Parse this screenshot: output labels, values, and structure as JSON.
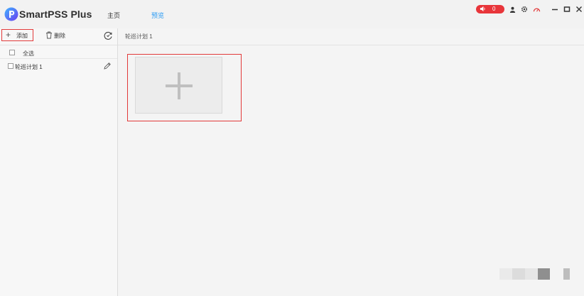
{
  "app": {
    "title": "SmartPSS Plus"
  },
  "nav": {
    "tabs": [
      {
        "label": "主页"
      },
      {
        "label": "预览"
      }
    ]
  },
  "alarm": {
    "count": "0"
  },
  "toolbar": {
    "add_label": "添加",
    "delete_label": "删除"
  },
  "list": {
    "select_all_label": "全选",
    "items": [
      {
        "label": "轮巡计划 1"
      }
    ]
  },
  "main": {
    "title": "轮巡计划 1"
  },
  "colors": {
    "accent": "#2b9bf4",
    "alarm": "#e8353a",
    "highlight": "#e23a3a"
  },
  "icons": [
    "app-logo-icon",
    "speaker-icon",
    "user-icon",
    "gear-icon",
    "speed-gauge-icon",
    "minimize-icon",
    "maximize-icon",
    "close-icon",
    "plus-icon",
    "trash-icon",
    "refresh-icon",
    "pencil-icon"
  ]
}
